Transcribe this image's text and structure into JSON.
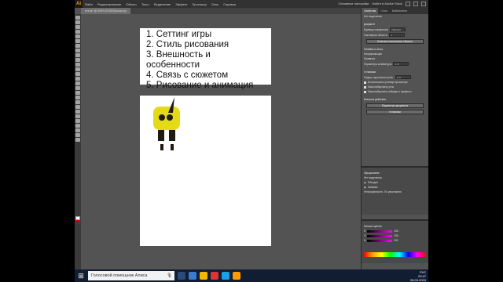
{
  "app": {
    "logo": "Ai",
    "menus": [
      "Файл",
      "Редактирование",
      "Объект",
      "Текст",
      "Выделение",
      "Эффект",
      "Просмотр",
      "Окно",
      "Справка"
    ],
    "workspace": "Основные настройки",
    "search_placeholder": "Найти в Adobe Stock"
  },
  "document": {
    "tab_label": "eve.ai* @ 300% (RGB/Просмотр)"
  },
  "artboard": {
    "items": [
      "1. Сеттинг игры",
      "2. Стиль рисования",
      "3. Внешность и особенности",
      "4. Связь с сюжетом",
      "5. Рисование и анимация"
    ]
  },
  "status": {
    "zoom": "300%",
    "page": "1",
    "selection": "Выделенный фрагмент"
  },
  "properties": {
    "tabs": [
      "Свойства",
      "Слои",
      "Библиотеки"
    ],
    "no_selection": "Нет выделения",
    "document_label": "Документ",
    "units_label": "Единицы измерения:",
    "units_value": "Пиксели",
    "artboard_label": "Монтажная область:",
    "artboard_value": "1",
    "edit_artboards_btn": "Изменить монтажные области",
    "rulers_label": "Линейки и сетка",
    "guides_label": "Направляющие",
    "snap_label": "Привязка",
    "prefs_label": "Параметры клавиатуры",
    "step_value": "1 пт",
    "settings_label": "Установки",
    "radius_label": "Радиус скругления углов:",
    "radius_value": "1 пт",
    "cb1": "Использовать границы просмотра",
    "cb2": "Масштабировать углы",
    "cb3": "Масштабировать обводки и эффекты",
    "quick_label": "Быстрые действия",
    "doc_setup_btn": "Параметры документа",
    "prefs_btn": "Установки"
  },
  "appearance": {
    "title": "Оформление",
    "no_selection": "Нет выделения",
    "stroke": "Обводка:",
    "fill": "Заливка:",
    "opacity": "Непрозрачность: По умолчанию"
  },
  "color": {
    "title": "Каталог цветов",
    "channels": [
      "R",
      "G",
      "B"
    ],
    "values": [
      "255",
      "255",
      "255"
    ]
  },
  "taskbar": {
    "search_text": "Голосовой помощник Алиса",
    "time": "23:47",
    "date": "26.03.2019",
    "lang": "РУС"
  }
}
